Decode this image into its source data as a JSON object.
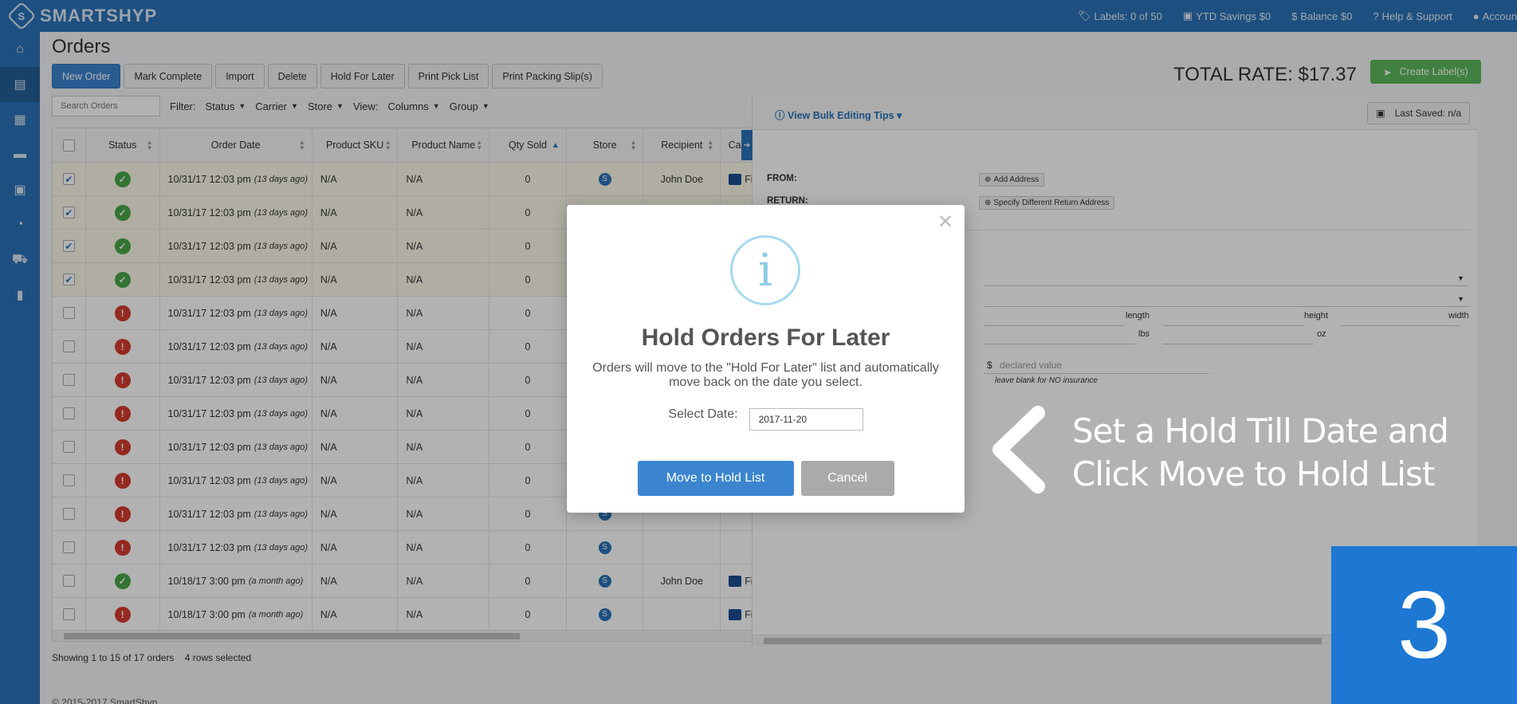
{
  "topbar": {
    "logo_mark": "S",
    "logo_text": "SMARTSHYP",
    "labels": "Labels: 0 of 50",
    "ytd_savings": "YTD Savings $0",
    "balance": "Balance $0",
    "help": "Help & Support",
    "account": "Accoun"
  },
  "page": {
    "title": "Orders",
    "toolbar": [
      "New Order",
      "Mark Complete",
      "Import",
      "Delete",
      "Hold For Later",
      "Print Pick List",
      "Print Packing Slip(s)"
    ],
    "search_placeholder": "Search Orders",
    "filter_label": "Filter:",
    "filters": [
      "Status",
      "Carrier",
      "Store"
    ],
    "view_label": "View:",
    "views": [
      "Columns",
      "Group"
    ],
    "total_rate": "TOTAL RATE: $17.37",
    "create_label": "Create Label(s)"
  },
  "grid": {
    "headers": [
      "Status",
      "Order Date",
      "Product SKU",
      "Product Name",
      "Qty Sold",
      "Store",
      "Recipient",
      "Carrier/S"
    ],
    "rows": [
      {
        "checked": true,
        "status": "ok",
        "date": "10/31/17 12:03 pm",
        "ago": "(13 days ago)",
        "sku": "N/A",
        "name": "N/A",
        "qty": "0",
        "store": true,
        "recipient": "John Doe",
        "carrier": "Fir"
      },
      {
        "checked": true,
        "status": "ok",
        "date": "10/31/17 12:03 pm",
        "ago": "(13 days ago)",
        "sku": "N/A",
        "name": "N/A",
        "qty": "0",
        "store": false,
        "recipient": "",
        "carrier": ""
      },
      {
        "checked": true,
        "status": "ok",
        "date": "10/31/17 12:03 pm",
        "ago": "(13 days ago)",
        "sku": "N/A",
        "name": "N/A",
        "qty": "0",
        "store": false,
        "recipient": "",
        "carrier": ""
      },
      {
        "checked": true,
        "status": "ok",
        "date": "10/31/17 12:03 pm",
        "ago": "(13 days ago)",
        "sku": "N/A",
        "name": "N/A",
        "qty": "0",
        "store": false,
        "recipient": "",
        "carrier": ""
      },
      {
        "checked": false,
        "status": "err",
        "date": "10/31/17 12:03 pm",
        "ago": "(13 days ago)",
        "sku": "N/A",
        "name": "N/A",
        "qty": "0",
        "store": false,
        "recipient": "",
        "carrier": ""
      },
      {
        "checked": false,
        "status": "err",
        "date": "10/31/17 12:03 pm",
        "ago": "(13 days ago)",
        "sku": "N/A",
        "name": "N/A",
        "qty": "0",
        "store": false,
        "recipient": "",
        "carrier": ""
      },
      {
        "checked": false,
        "status": "err",
        "date": "10/31/17 12:03 pm",
        "ago": "(13 days ago)",
        "sku": "N/A",
        "name": "N/A",
        "qty": "0",
        "store": false,
        "recipient": "",
        "carrier": ""
      },
      {
        "checked": false,
        "status": "err",
        "date": "10/31/17 12:03 pm",
        "ago": "(13 days ago)",
        "sku": "N/A",
        "name": "N/A",
        "qty": "0",
        "store": false,
        "recipient": "",
        "carrier": ""
      },
      {
        "checked": false,
        "status": "err",
        "date": "10/31/17 12:03 pm",
        "ago": "(13 days ago)",
        "sku": "N/A",
        "name": "N/A",
        "qty": "0",
        "store": false,
        "recipient": "",
        "carrier": ""
      },
      {
        "checked": false,
        "status": "err",
        "date": "10/31/17 12:03 pm",
        "ago": "(13 days ago)",
        "sku": "N/A",
        "name": "N/A",
        "qty": "0",
        "store": false,
        "recipient": "",
        "carrier": ""
      },
      {
        "checked": false,
        "status": "err",
        "date": "10/31/17 12:03 pm",
        "ago": "(13 days ago)",
        "sku": "N/A",
        "name": "N/A",
        "qty": "0",
        "store": true,
        "recipient": "",
        "carrier": ""
      },
      {
        "checked": false,
        "status": "err",
        "date": "10/31/17 12:03 pm",
        "ago": "(13 days ago)",
        "sku": "N/A",
        "name": "N/A",
        "qty": "0",
        "store": true,
        "recipient": "",
        "carrier": ""
      },
      {
        "checked": false,
        "status": "ok",
        "date": "10/18/17 3:00 pm",
        "ago": "(a month ago)",
        "sku": "N/A",
        "name": "N/A",
        "qty": "0",
        "store": true,
        "recipient": "John Doe",
        "carrier": "Fir"
      },
      {
        "checked": false,
        "status": "err",
        "date": "10/18/17 3:00 pm",
        "ago": "(a month ago)",
        "sku": "N/A",
        "name": "N/A",
        "qty": "0",
        "store": true,
        "recipient": "",
        "carrier": "Fir"
      }
    ],
    "footer": "Showing 1 to 15 of 17 orders    4 rows selected",
    "copyright": "© 2015-2017 SmartShyp"
  },
  "panel": {
    "bulk_tips": "View Bulk Editing Tips",
    "last_saved": "Last Saved: n/a",
    "from_label": "FROM:",
    "return_label": "RETURN:",
    "add_address": "Add Address",
    "specify_return": "Specify Different Return Address",
    "length": "length",
    "height": "height",
    "width": "width",
    "lbs": "lbs",
    "oz": "oz",
    "currency": "$",
    "declared_placeholder": "declared value",
    "insurance_note": "leave blank for NO insurance"
  },
  "modal": {
    "icon": "i",
    "title": "Hold Orders For Later",
    "text": "Orders will move to the \"Hold For Later\" list and automatically move back on the date you select.",
    "date_label": "Select Date:",
    "date_value": "2017-11-20",
    "move_button": "Move to Hold List",
    "cancel_button": "Cancel"
  },
  "callout": {
    "line1": "Set a Hold Till Date and",
    "line2": "Click Move to Hold List",
    "step": "3"
  },
  "colors": {
    "brand": "#2a73b8",
    "primary_button": "#3b85d0",
    "ok": "#4aa64a",
    "error": "#d63b2f",
    "step_box": "#1d77d3"
  }
}
